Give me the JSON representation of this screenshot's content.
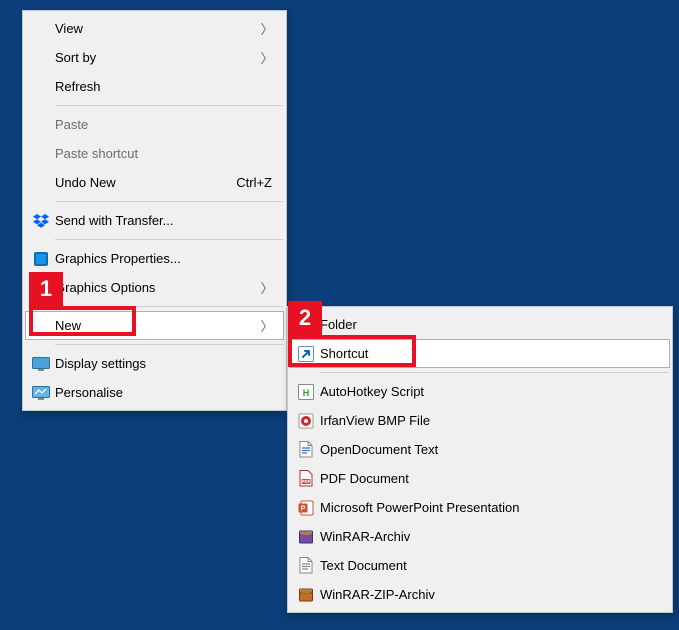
{
  "callouts": {
    "one": "1",
    "two": "2"
  },
  "main_menu": {
    "view": {
      "label": "View"
    },
    "sort_by": {
      "label": "Sort by"
    },
    "refresh": {
      "label": "Refresh"
    },
    "paste": {
      "label": "Paste"
    },
    "paste_shortcut": {
      "label": "Paste shortcut"
    },
    "undo_new": {
      "label": "Undo New",
      "shortcut": "Ctrl+Z"
    },
    "send_with_transfer": {
      "label": "Send with Transfer..."
    },
    "graphics_properties": {
      "label": "Graphics Properties..."
    },
    "graphics_options": {
      "label": "Graphics Options"
    },
    "new": {
      "label": "New"
    },
    "display_settings": {
      "label": "Display settings"
    },
    "personalise": {
      "label": "Personalise"
    }
  },
  "sub_menu": {
    "folder": {
      "label": "Folder"
    },
    "shortcut": {
      "label": "Shortcut"
    },
    "autohotkey": {
      "label": "AutoHotkey Script"
    },
    "irfanview_bmp": {
      "label": "IrfanView BMP File"
    },
    "opendocument_text": {
      "label": "OpenDocument Text"
    },
    "pdf_document": {
      "label": "PDF Document"
    },
    "powerpoint": {
      "label": "Microsoft PowerPoint Presentation"
    },
    "winrar_archiv": {
      "label": "WinRAR-Archiv"
    },
    "text_document": {
      "label": "Text Document"
    },
    "winrar_zip_archiv": {
      "label": "WinRAR-ZIP-Archiv"
    }
  }
}
